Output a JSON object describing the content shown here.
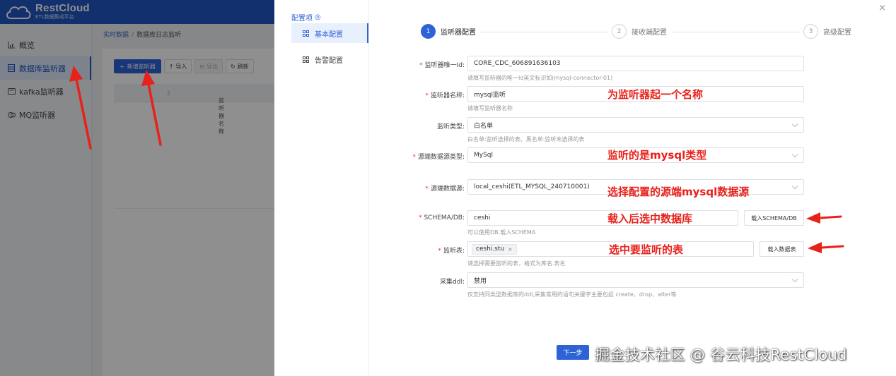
{
  "app": {
    "logo_name": "RestCloud",
    "logo_sub": "ETL数据集成平台",
    "brand_color": "#1f57c3"
  },
  "sidebar": {
    "items": [
      {
        "label": "概览",
        "icon": "bar-chart-icon"
      },
      {
        "label": "数据库监听器",
        "icon": "database-icon",
        "active": true
      },
      {
        "label": "kafka监听器",
        "icon": "kafka-icon"
      },
      {
        "label": "MQ监听器",
        "icon": "mq-icon"
      }
    ]
  },
  "breadcrumb": {
    "root": "实时数据",
    "sep": "/",
    "current": "数据库日志监听"
  },
  "toolbar": {
    "add_label": "新增监听器",
    "import_label": "导入",
    "export_label": "导出",
    "refresh_label": "刷新"
  },
  "table": {
    "col_name": "监听器名称"
  },
  "drawer": {
    "nav_title": "配置项",
    "nav_items": [
      {
        "label": "基本配置",
        "active": true
      },
      {
        "label": "告警配置"
      }
    ],
    "steps": [
      {
        "num": "1",
        "label": "监听器配置"
      },
      {
        "num": "2",
        "label": "接收端配置"
      },
      {
        "num": "3",
        "label": "高级配置"
      }
    ],
    "form": {
      "listener_id": {
        "label": "监听器唯一Id:",
        "value": "CORE_CDC_606891636103",
        "hint": "请填写监听器的唯一Id英文标识如(mysql-connector-01)"
      },
      "listener_name": {
        "label": "监听器名称:",
        "value": "mysql监听",
        "hint": "请填写监听器名称"
      },
      "listen_type": {
        "label": "监听类型:",
        "value": "白名单",
        "hint": "白名单:监听选择的表、黑名单:监听未选择的表"
      },
      "source_type": {
        "label": "源端数据源类型:",
        "value": "MySql"
      },
      "source": {
        "label": "源端数据源:",
        "value": "local_ceshi(ETL_MYSQL_240710001)"
      },
      "schema": {
        "label": "SCHEMA/DB:",
        "value": "ceshi",
        "button": "载入SCHEMA/DB",
        "hint": "可以使用DB.载入SCHEMA"
      },
      "tables": {
        "label": "监听表:",
        "tag": "ceshi.stu",
        "tag_remove": "×",
        "button": "载入数据表",
        "hint": "请选择需要监听的表，格式为库名.表名"
      },
      "ddl": {
        "label": "采集ddl:",
        "value": "禁用",
        "hint": "仅支持同类型数据库的ddl,采集常用的语句关键字主要包括 create、drop、alter等"
      }
    },
    "next_label": "下一步",
    "close_label": "×"
  },
  "annotations": {
    "name": "为监听器起一个名称",
    "type": "监听的是mysql类型",
    "source": "选择配置的源端mysql数据源",
    "schema": "载入后选中数据库",
    "tables": "选中要监听的表",
    "color": "#e8211b"
  },
  "watermark": "掘金技术社区 @ 谷云科技RestCloud"
}
